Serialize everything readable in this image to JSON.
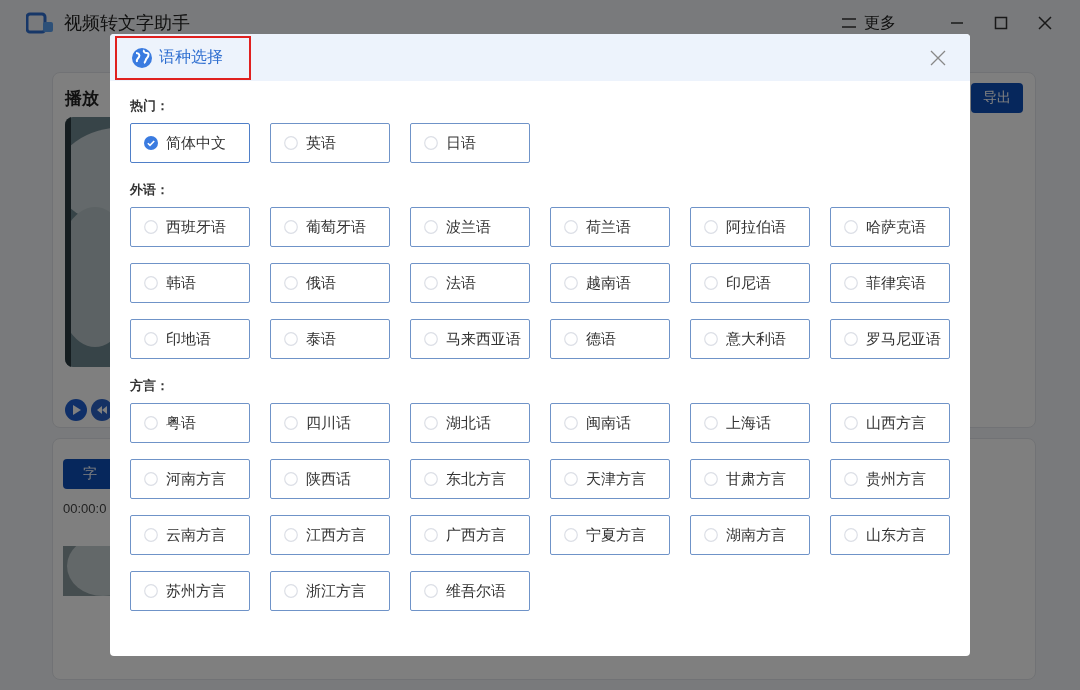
{
  "app": {
    "title": "视频转文字助手",
    "more": "更多",
    "player_title": "播放",
    "export_button": "导出",
    "subtitle_button": "字",
    "timecode": "00:00:0"
  },
  "dialog": {
    "title": "语种选择",
    "title_highlighted": true,
    "sections": [
      {
        "label": "热门：",
        "options": [
          {
            "label": "简体中文",
            "selected": true
          },
          {
            "label": "英语",
            "selected": false
          },
          {
            "label": "日语",
            "selected": false
          }
        ]
      },
      {
        "label": "外语：",
        "options": [
          {
            "label": "西班牙语",
            "selected": false
          },
          {
            "label": "葡萄牙语",
            "selected": false
          },
          {
            "label": "波兰语",
            "selected": false
          },
          {
            "label": "荷兰语",
            "selected": false
          },
          {
            "label": "阿拉伯语",
            "selected": false
          },
          {
            "label": "哈萨克语",
            "selected": false
          },
          {
            "label": "韩语",
            "selected": false
          },
          {
            "label": "俄语",
            "selected": false
          },
          {
            "label": "法语",
            "selected": false
          },
          {
            "label": "越南语",
            "selected": false
          },
          {
            "label": "印尼语",
            "selected": false
          },
          {
            "label": "菲律宾语",
            "selected": false
          },
          {
            "label": "印地语",
            "selected": false
          },
          {
            "label": "泰语",
            "selected": false
          },
          {
            "label": "马来西亚语",
            "selected": false
          },
          {
            "label": "德语",
            "selected": false
          },
          {
            "label": "意大利语",
            "selected": false
          },
          {
            "label": "罗马尼亚语",
            "selected": false
          }
        ]
      },
      {
        "label": "方言：",
        "options": [
          {
            "label": "粤语",
            "selected": false
          },
          {
            "label": "四川话",
            "selected": false
          },
          {
            "label": "湖北话",
            "selected": false
          },
          {
            "label": "闽南话",
            "selected": false
          },
          {
            "label": "上海话",
            "selected": false
          },
          {
            "label": "山西方言",
            "selected": false
          },
          {
            "label": "河南方言",
            "selected": false
          },
          {
            "label": "陕西话",
            "selected": false
          },
          {
            "label": "东北方言",
            "selected": false
          },
          {
            "label": "天津方言",
            "selected": false
          },
          {
            "label": "甘肃方言",
            "selected": false
          },
          {
            "label": "贵州方言",
            "selected": false
          },
          {
            "label": "云南方言",
            "selected": false
          },
          {
            "label": "江西方言",
            "selected": false
          },
          {
            "label": "广西方言",
            "selected": false
          },
          {
            "label": "宁夏方言",
            "selected": false
          },
          {
            "label": "湖南方言",
            "selected": false
          },
          {
            "label": "山东方言",
            "selected": false
          },
          {
            "label": "苏州方言",
            "selected": false
          },
          {
            "label": "浙江方言",
            "selected": false
          },
          {
            "label": "维吾尔语",
            "selected": false
          }
        ]
      }
    ]
  }
}
